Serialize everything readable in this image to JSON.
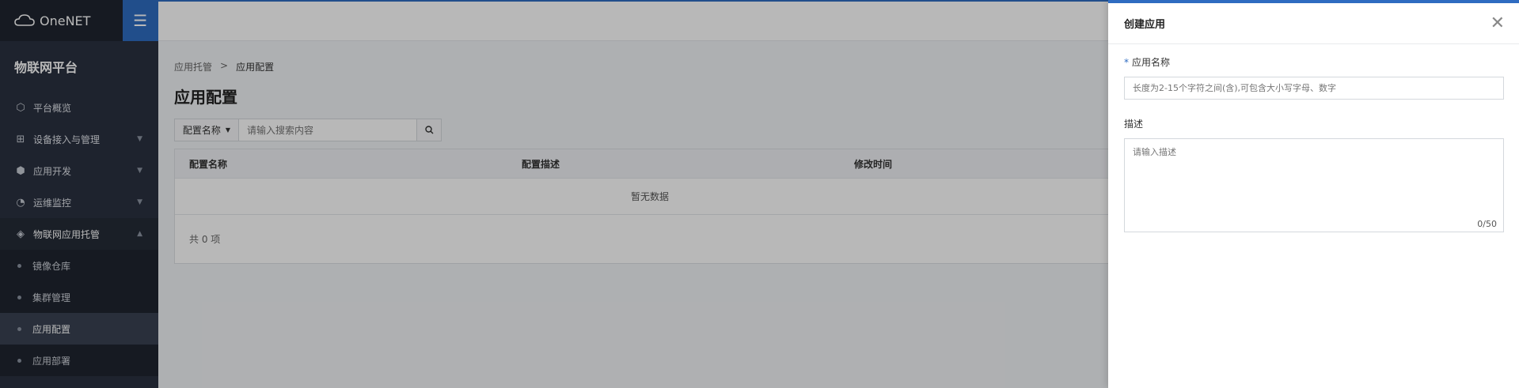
{
  "sidebar": {
    "logo_text": "OneNET",
    "platform_title": "物联网平台",
    "items": [
      {
        "label": "平台概览",
        "icon": "hexagon-icon"
      },
      {
        "label": "设备接入与管理",
        "icon": "device-icon"
      },
      {
        "label": "应用开发",
        "icon": "cube-icon"
      },
      {
        "label": "运维监控",
        "icon": "pie-icon"
      },
      {
        "label": "物联网应用托管",
        "icon": "layers-icon"
      }
    ],
    "sub_items": [
      {
        "label": "镜像仓库"
      },
      {
        "label": "集群管理"
      },
      {
        "label": "应用配置",
        "active": true
      },
      {
        "label": "应用部署"
      }
    ]
  },
  "breadcrumb": {
    "parent": "应用托管",
    "separator": ">",
    "current": "应用配置"
  },
  "main": {
    "title": "应用配置",
    "search": {
      "filter_label": "配置名称",
      "placeholder": "请输入搜索内容"
    },
    "table": {
      "columns": [
        "配置名称",
        "配置描述",
        "修改时间"
      ],
      "empty_text": "暂无数据",
      "total_text": "共 0 项"
    }
  },
  "drawer": {
    "title": "创建应用",
    "name_label": "应用名称",
    "required_mark": "*",
    "name_placeholder": "长度为2-15个字符之间(含),可包含大小写字母、数字",
    "desc_label": "描述",
    "desc_placeholder": "请输入描述",
    "desc_count": "0/50"
  },
  "colors": {
    "accent": "#2f6cc1",
    "sidebar_bg": "#2a3140"
  }
}
